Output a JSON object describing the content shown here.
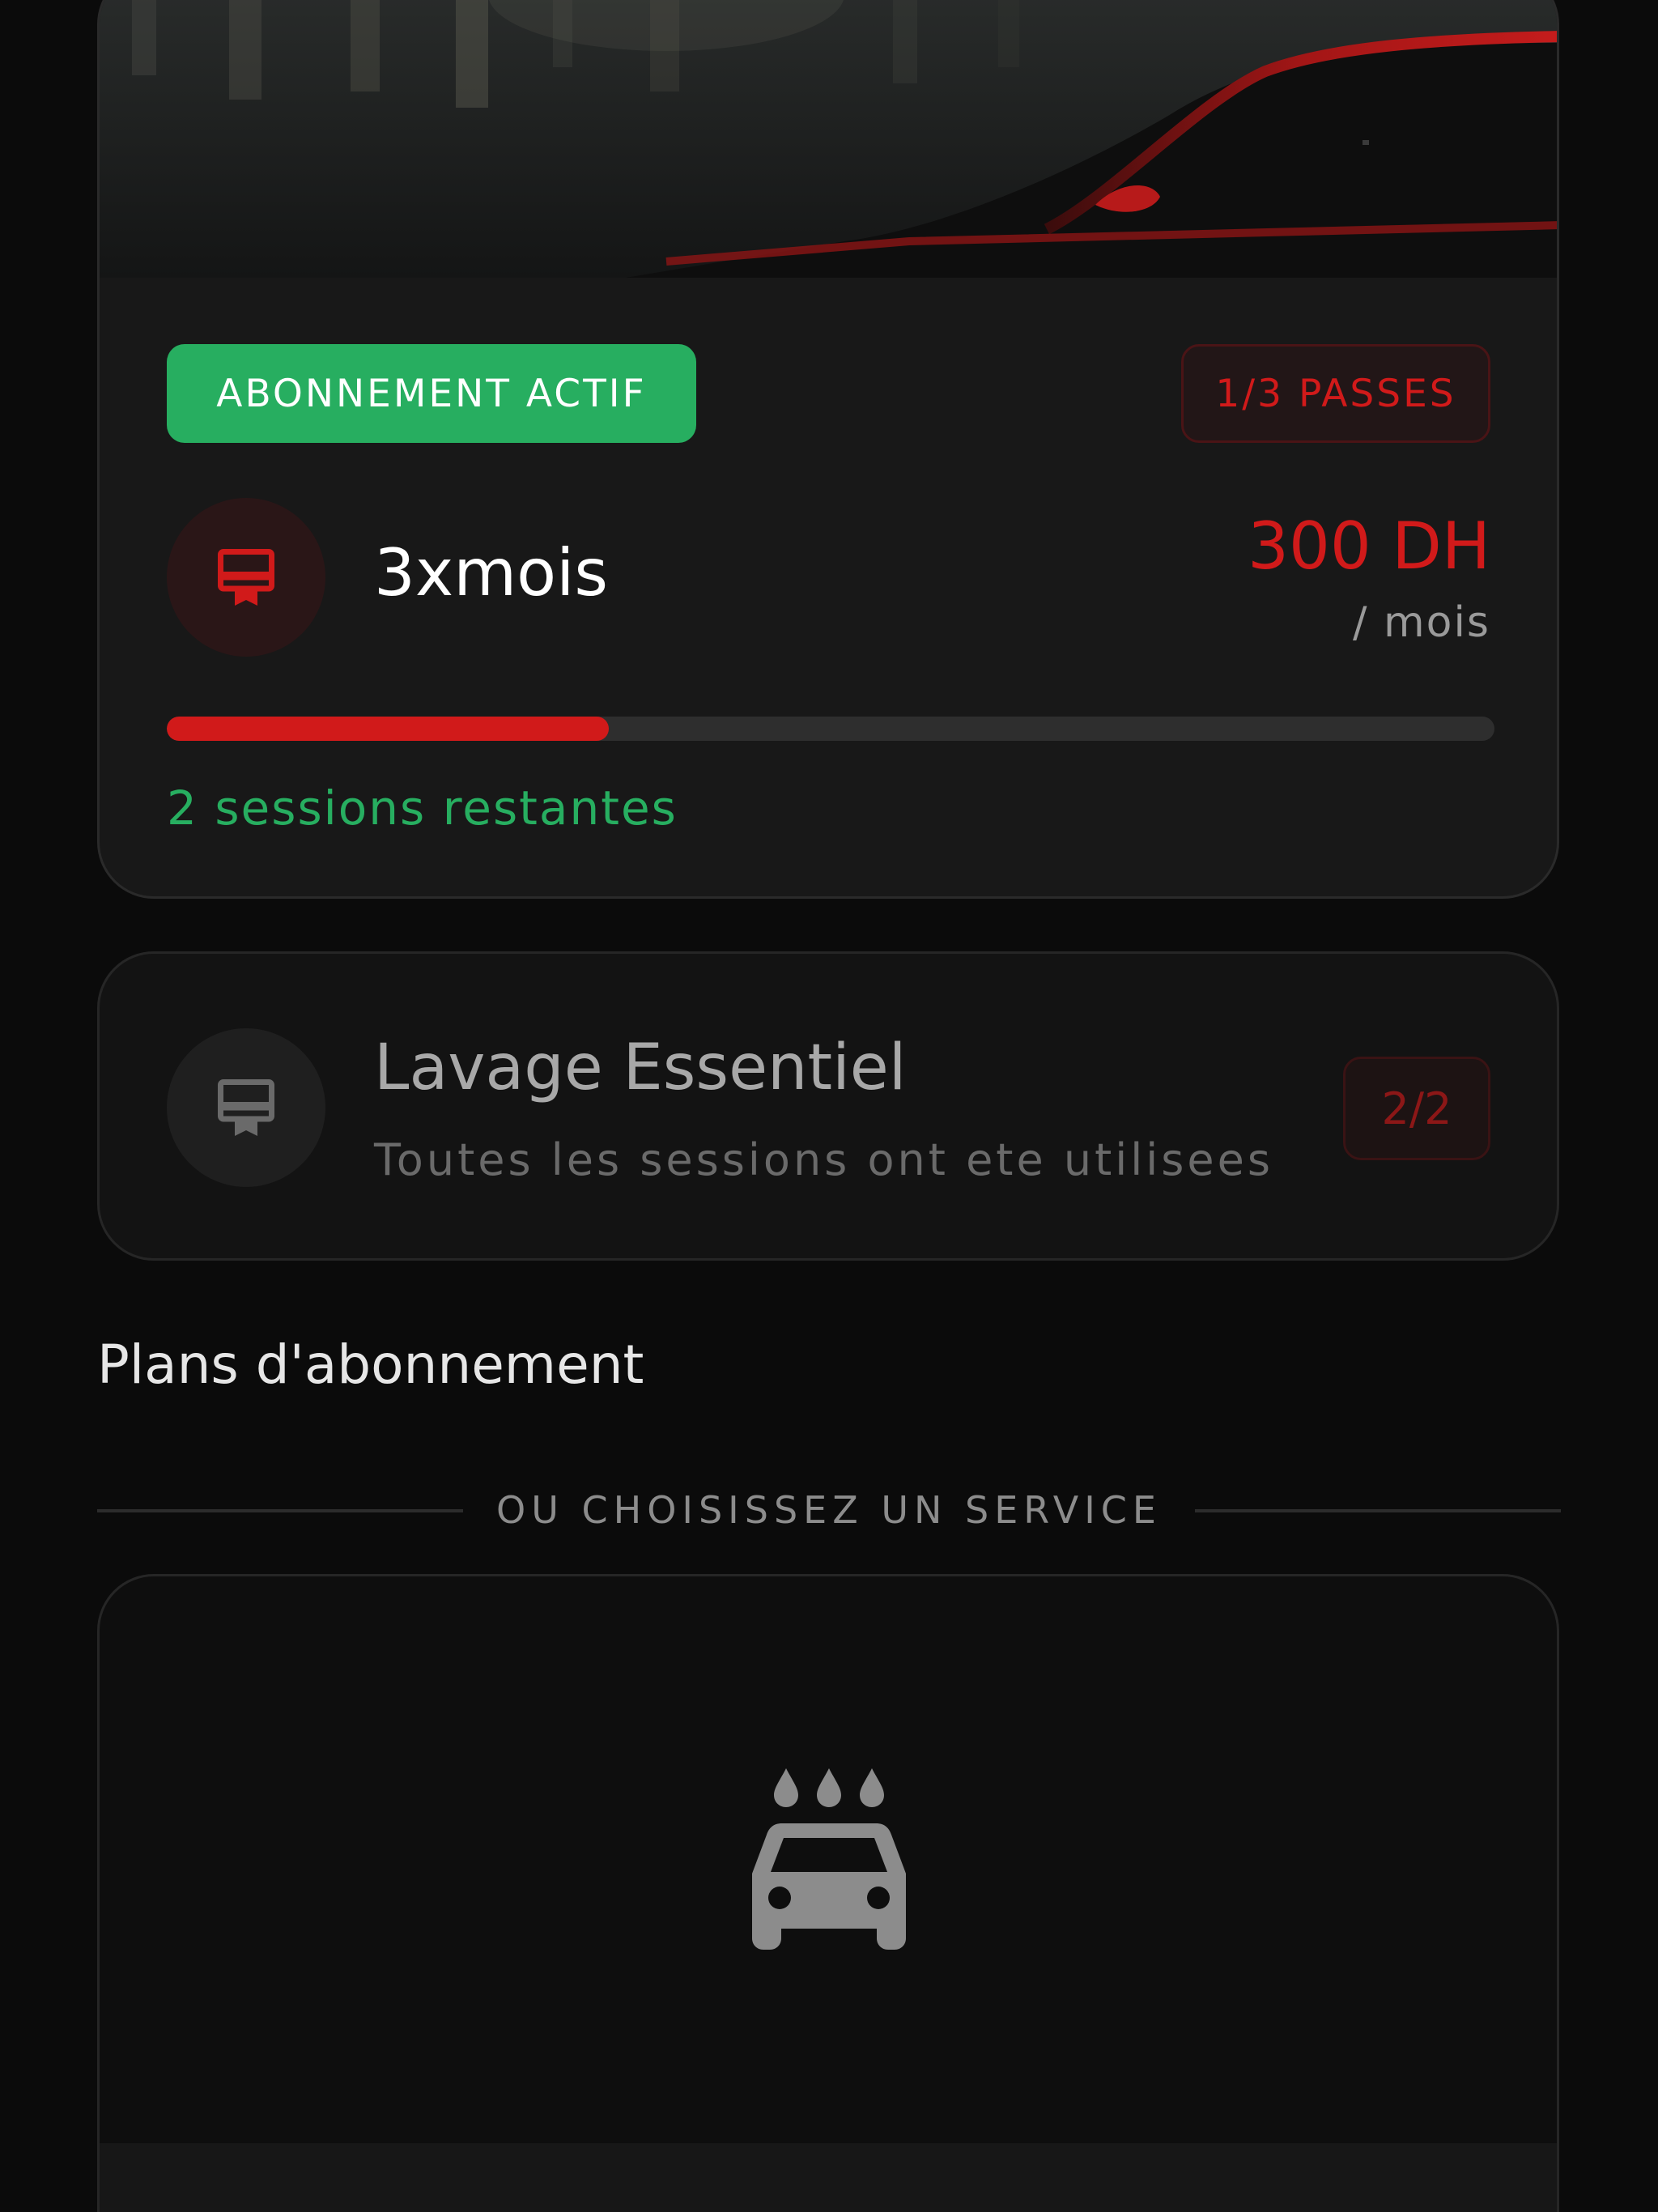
{
  "active_subscription": {
    "status_badge": "ABONNEMENT ACTIF",
    "passes_badge": "1/3 PASSES",
    "plan_name": "3xmois",
    "price": "300 DH",
    "price_period": "/ mois",
    "progress": 0.333,
    "sessions_left": "2 sessions restantes",
    "icon": "card-membership-icon"
  },
  "used_subscription": {
    "name": "Lavage Essentiel",
    "subtitle": "Toutes les sessions ont ete utilisees",
    "count_badge": "2/2",
    "icon": "card-membership-icon"
  },
  "plans_section": {
    "title": "Plans d'abonnement"
  },
  "divider": {
    "label": "OU CHOISISSEZ UN SERVICE"
  },
  "service_card": {
    "icon": "car-wash-icon"
  },
  "colors": {
    "accent_red": "#d11a1a",
    "success_green": "#27ae60",
    "background": "#0b0b0b",
    "card": "#181818"
  }
}
